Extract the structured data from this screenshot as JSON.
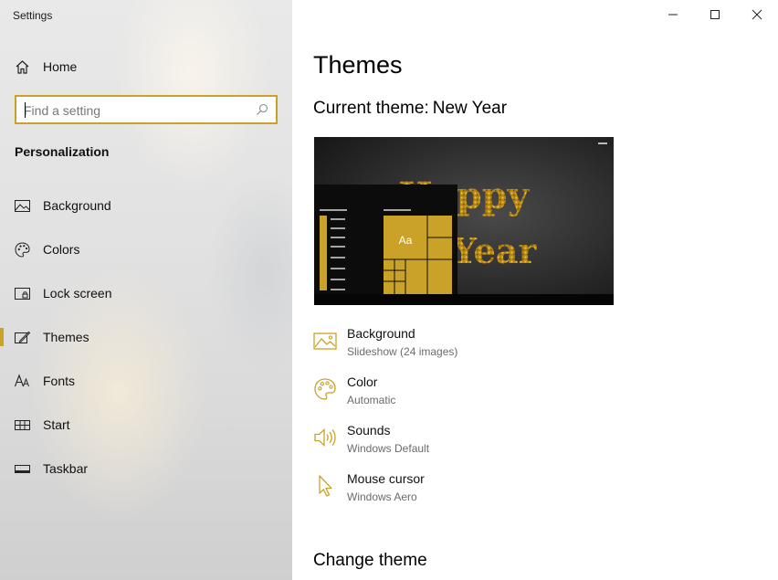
{
  "window": {
    "title": "Settings",
    "controls": {
      "minimize": "minimize-icon",
      "maximize": "maximize-icon",
      "close": "close-icon"
    }
  },
  "sidebar": {
    "home_label": "Home",
    "search": {
      "placeholder": "Find a setting",
      "value": ""
    },
    "section_title": "Personalization",
    "items": [
      {
        "label": "Background",
        "icon": "picture-icon",
        "selected": false
      },
      {
        "label": "Colors",
        "icon": "palette-icon",
        "selected": false
      },
      {
        "label": "Lock screen",
        "icon": "lock-screen-icon",
        "selected": false
      },
      {
        "label": "Themes",
        "icon": "themes-icon",
        "selected": true
      },
      {
        "label": "Fonts",
        "icon": "fonts-icon",
        "selected": false
      },
      {
        "label": "Start",
        "icon": "start-icon",
        "selected": false
      },
      {
        "label": "Taskbar",
        "icon": "taskbar-icon",
        "selected": false
      }
    ]
  },
  "main": {
    "title": "Themes",
    "current_theme_label": "Current theme:",
    "current_theme_name": "New Year",
    "preview": {
      "tile_text": "Aa",
      "wallpaper_text_line1": "Happy",
      "wallpaper_text_line2": "New Year"
    },
    "properties": [
      {
        "title": "Background",
        "value": "Slideshow (24 images)",
        "icon": "picture-icon"
      },
      {
        "title": "Color",
        "value": "Automatic",
        "icon": "palette-icon"
      },
      {
        "title": "Sounds",
        "value": "Windows Default",
        "icon": "speaker-icon"
      },
      {
        "title": "Mouse cursor",
        "value": "Windows Aero",
        "icon": "cursor-icon"
      }
    ],
    "change_theme_heading": "Change theme"
  },
  "colors": {
    "accent": "#c9a227",
    "sidebar_bg": "#e2e2e2",
    "text_secondary": "#6b6b6b"
  }
}
